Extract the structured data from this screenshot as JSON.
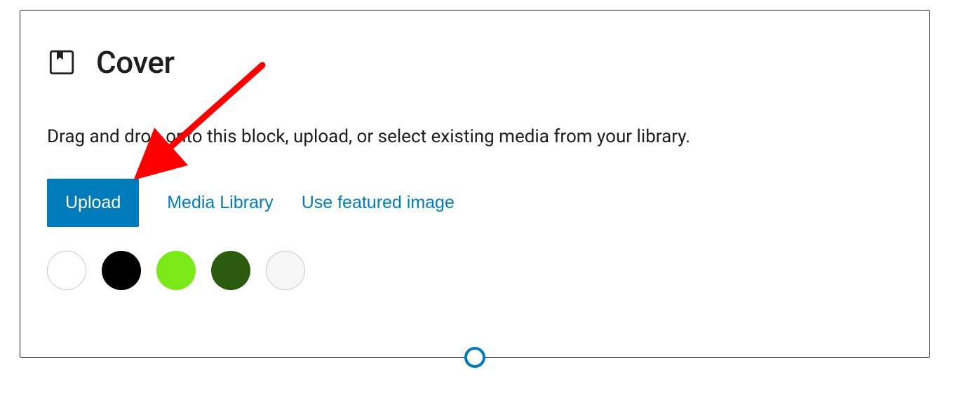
{
  "block": {
    "title": "Cover",
    "instructions": "Drag and drop onto this block, upload, or select existing media from your library."
  },
  "actions": {
    "upload_label": "Upload",
    "media_library_label": "Media Library",
    "featured_image_label": "Use featured image"
  },
  "colors": {
    "swatches": [
      {
        "name": "white",
        "value": "#ffffff",
        "bordered": true
      },
      {
        "name": "black",
        "value": "#000000",
        "bordered": false
      },
      {
        "name": "bright-green",
        "value": "#7be817",
        "bordered": false
      },
      {
        "name": "dark-green",
        "value": "#2b5b0f",
        "bordered": false
      },
      {
        "name": "off-white",
        "value": "#f6f6f6",
        "bordered": true
      }
    ]
  },
  "annotation": {
    "arrow_color": "#ff0000"
  }
}
